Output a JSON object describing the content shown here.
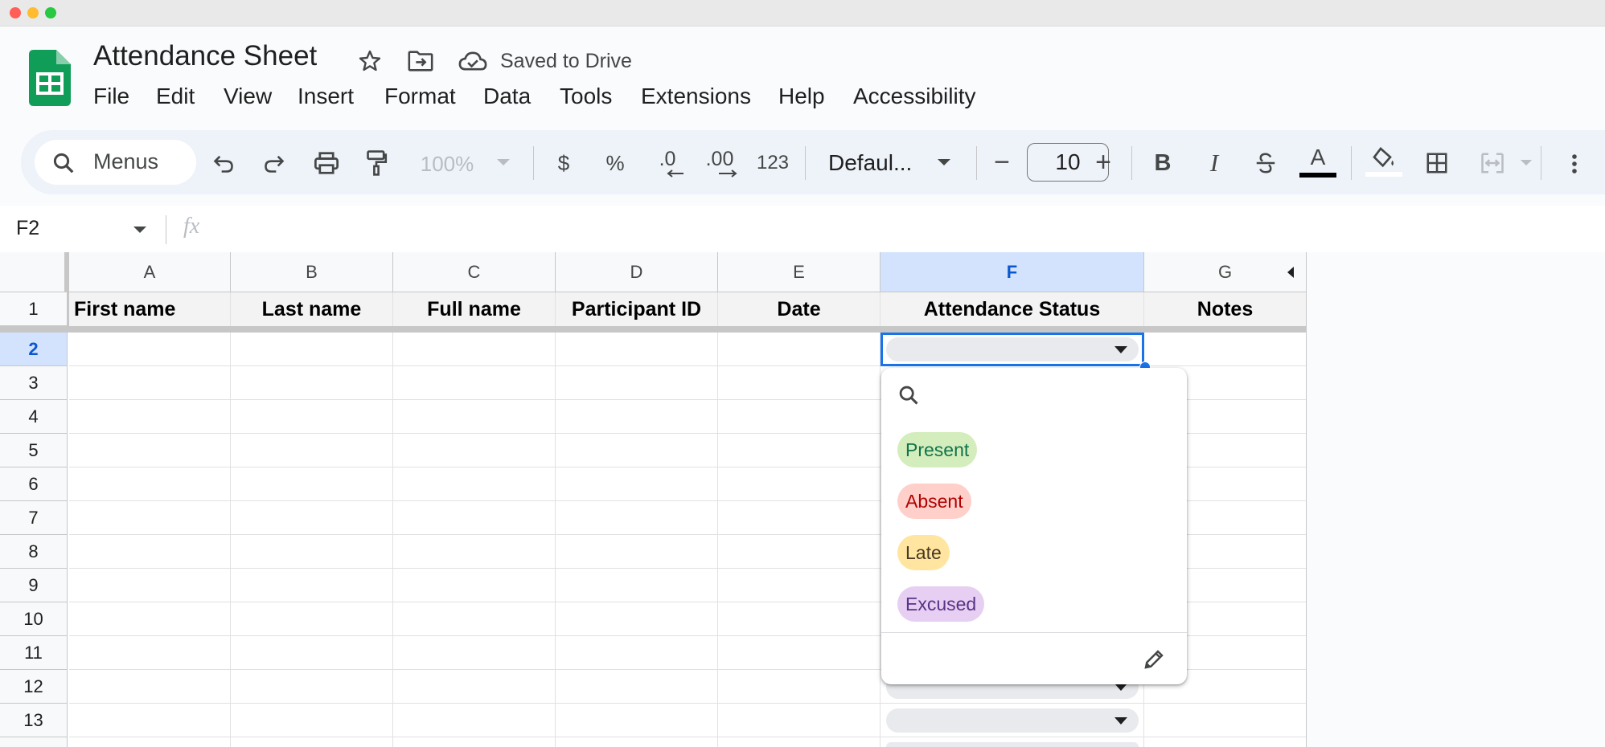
{
  "window": {
    "title": "Attendance Sheet",
    "status": "Saved to Drive"
  },
  "menu": [
    "File",
    "Edit",
    "View",
    "Insert",
    "Format",
    "Data",
    "Tools",
    "Extensions",
    "Help",
    "Accessibility"
  ],
  "toolbar": {
    "search_label": "Menus",
    "zoom": "100%",
    "currency": "$",
    "percent": "%",
    "decrease_decimal": ".0",
    "increase_decimal": ".00",
    "number_format": "123",
    "font_name": "Defaul...",
    "font_size": "10",
    "minus": "−",
    "plus": "+",
    "bold": "B",
    "italic": "I",
    "text_color_letter": "A"
  },
  "formula_bar": {
    "cell_ref": "F2",
    "fx": "fx"
  },
  "grid": {
    "columns": [
      "A",
      "B",
      "C",
      "D",
      "E",
      "F",
      "G"
    ],
    "selected_column": "F",
    "rows": [
      "1",
      "2",
      "3",
      "4",
      "5",
      "6",
      "7",
      "8",
      "9",
      "10",
      "11",
      "12",
      "13"
    ],
    "selected_row": "2",
    "headers": [
      "First name",
      "Last name",
      "Full name",
      "Participant ID",
      "Date",
      "Attendance Status",
      "Notes"
    ]
  },
  "dropdown": {
    "options": [
      {
        "label": "Present",
        "bg": "#d4edbc",
        "fg": "#11734b"
      },
      {
        "label": "Absent",
        "bg": "#ffcfc9",
        "fg": "#b10202"
      },
      {
        "label": "Late",
        "bg": "#ffe5a0",
        "fg": "#473821"
      },
      {
        "label": "Excused",
        "bg": "#e6cff2",
        "fg": "#5a3286"
      }
    ]
  },
  "colors": {
    "accent": "#0b57d0",
    "sheets_green": "#0f9d58",
    "selection_header": "#d3e3fd"
  }
}
